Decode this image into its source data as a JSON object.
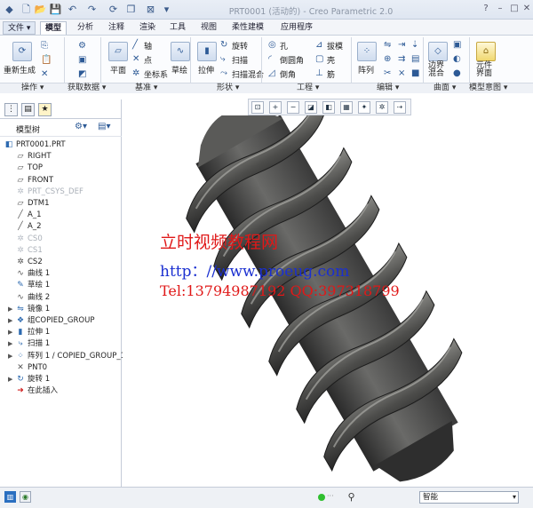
{
  "window": {
    "title": "PRT0001 (活动的) - Creo Parametric 2.0",
    "controls": {
      "help": "?",
      "minimize": "–",
      "maximize": "□",
      "close": "✕"
    }
  },
  "quick_access": {
    "new": "🗋",
    "open": "📂",
    "save": "💾",
    "undo": "↶",
    "redo": "↷",
    "regen": "⟳",
    "windows": "❐",
    "close": "⊠",
    "more": "▾"
  },
  "tabs": [
    "文件",
    "模型",
    "分析",
    "注释",
    "渲染",
    "工具",
    "视图",
    "柔性建模",
    "应用程序"
  ],
  "ribbon": {
    "regen_label": "重新生成",
    "plane_label": "平面",
    "datum_axis": "轴",
    "datum_point": "点",
    "datum_csys": "坐标系",
    "sketch_label": "草绘",
    "extrude_label": "拉伸",
    "revolve_label": "旋转",
    "sweep_label": "扫描",
    "swept_blend_label": "扫描混合",
    "hole_label": "孔",
    "round_label": "倒圆角",
    "chamfer_label": "倒角",
    "draft_label": "拔模",
    "shell_label": "壳",
    "rib_label": "筋",
    "pattern_label": "阵列",
    "boundary_blend_label": "边界\n混合",
    "component_interface_label": "元件\n界面"
  },
  "groups": [
    "操作",
    "获取数据",
    "基准",
    "形状",
    "工程",
    "编辑",
    "曲面",
    "模型意图"
  ],
  "view_toolbar_icons": [
    "zoom-fit",
    "zoom-in",
    "zoom-out",
    "repaint",
    "display-style",
    "saved-views",
    "datum-display",
    "spin-center",
    "annotation"
  ],
  "panel": {
    "tabs": [
      "tree-tab",
      "folder-tab",
      "favorites-tab"
    ],
    "header": "模型树",
    "tree": [
      {
        "label": "PRT0001.PRT",
        "icon": "part",
        "grey": false,
        "indent": 0,
        "expand": false
      },
      {
        "label": "RIGHT",
        "icon": "plane",
        "grey": false,
        "indent": 1,
        "expand": false
      },
      {
        "label": "TOP",
        "icon": "plane",
        "grey": false,
        "indent": 1,
        "expand": false
      },
      {
        "label": "FRONT",
        "icon": "plane",
        "grey": false,
        "indent": 1,
        "expand": false
      },
      {
        "label": "PRT_CSYS_DEF",
        "icon": "csys",
        "grey": true,
        "indent": 1,
        "expand": false
      },
      {
        "label": "DTM1",
        "icon": "plane",
        "grey": false,
        "indent": 1,
        "expand": false
      },
      {
        "label": "A_1",
        "icon": "axis",
        "grey": false,
        "indent": 1,
        "expand": false
      },
      {
        "label": "A_2",
        "icon": "axis",
        "grey": false,
        "indent": 1,
        "expand": false
      },
      {
        "label": "CS0",
        "icon": "csys",
        "grey": true,
        "indent": 1,
        "expand": false
      },
      {
        "label": "CS1",
        "icon": "csys",
        "grey": true,
        "indent": 1,
        "expand": false
      },
      {
        "label": "CS2",
        "icon": "csys",
        "grey": false,
        "indent": 1,
        "expand": false
      },
      {
        "label": "曲线 1",
        "icon": "curve",
        "grey": false,
        "indent": 1,
        "expand": false
      },
      {
        "label": "草绘 1",
        "icon": "sketch",
        "grey": false,
        "indent": 1,
        "expand": false
      },
      {
        "label": "曲线 2",
        "icon": "curve",
        "grey": false,
        "indent": 1,
        "expand": false
      },
      {
        "label": "镜像 1",
        "icon": "mirror",
        "grey": false,
        "indent": 1,
        "expand": true
      },
      {
        "label": "组COPIED_GROUP",
        "icon": "group",
        "grey": false,
        "indent": 1,
        "expand": true
      },
      {
        "label": "拉伸 1",
        "icon": "extrude",
        "grey": false,
        "indent": 1,
        "expand": true
      },
      {
        "label": "扫描 1",
        "icon": "sweep",
        "grey": false,
        "indent": 1,
        "expand": true
      },
      {
        "label": "阵列 1 / COPIED_GROUP_1",
        "icon": "pattern",
        "grey": false,
        "indent": 1,
        "expand": true
      },
      {
        "label": "PNT0",
        "icon": "point",
        "grey": false,
        "indent": 1,
        "expand": false
      },
      {
        "label": "旋转 1",
        "icon": "revolve",
        "grey": false,
        "indent": 1,
        "expand": true
      },
      {
        "label": "在此插入",
        "icon": "insert",
        "grey": false,
        "indent": 1,
        "expand": false
      }
    ]
  },
  "watermark": {
    "line1": "立时视频教程网",
    "line2": "http：//www.proeug.com",
    "line3": "Tel:13794987192  QQ:397318799"
  },
  "status": {
    "filter_value": "智能"
  },
  "colors": {
    "watermark_red": "#e01818",
    "watermark_blue": "#1a2fd0",
    "accent": "#2d5a96"
  }
}
